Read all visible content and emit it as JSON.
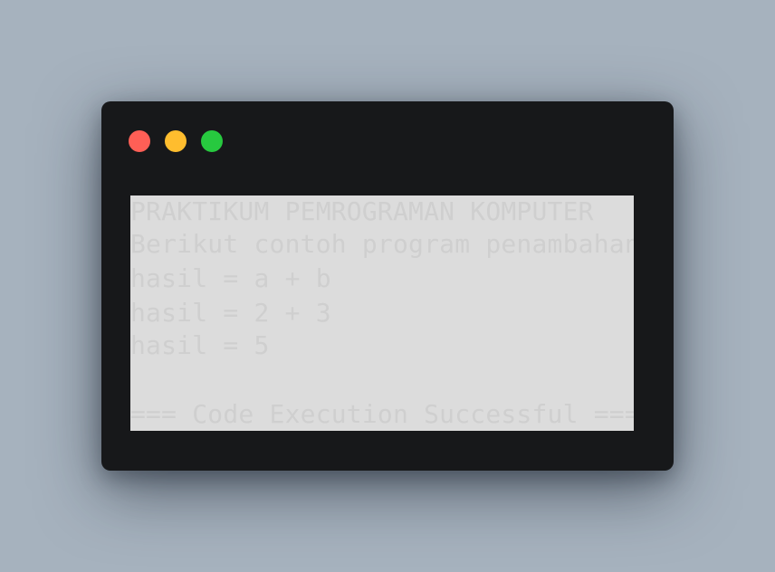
{
  "window": {
    "controls": [
      "close-icon",
      "minimize-icon",
      "maximize-icon"
    ]
  },
  "console": {
    "lines": [
      "PRAKTIKUM PEMROGRAMAN KOMPUTER",
      "Berikut contoh program penambahan",
      "hasil = a + b",
      "hasil = 2 + 3",
      "hasil = 5"
    ],
    "status": "=== Code Execution Successful ==="
  },
  "colors": {
    "background": "#a6b2be",
    "window": "#17181a",
    "output_bg": "#dcdcdc",
    "text": "#cfcfcf",
    "close": "#ff5f56",
    "minimize": "#ffbd2e",
    "maximize": "#27c93f"
  }
}
